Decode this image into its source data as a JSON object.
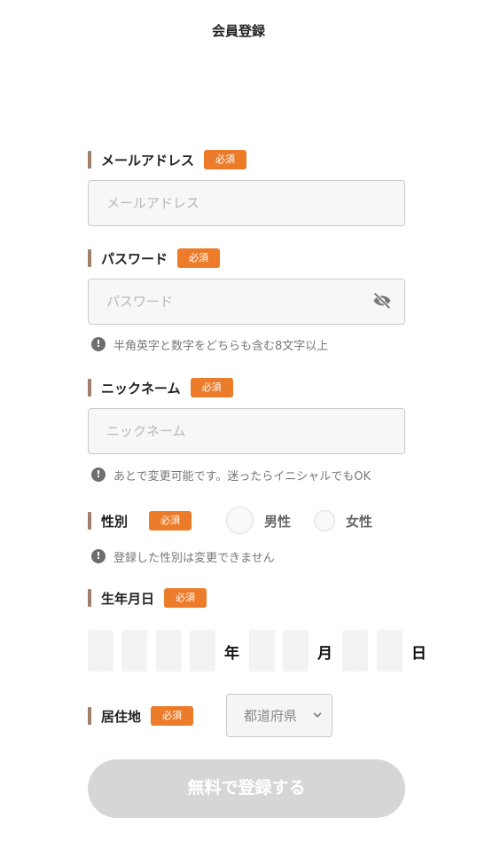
{
  "header": {
    "title": "会員登録"
  },
  "required_label": "必須",
  "email": {
    "label": "メールアドレス",
    "placeholder": "メールアドレス"
  },
  "password": {
    "label": "パスワード",
    "placeholder": "パスワード",
    "toggle_icon": "eye-slash-icon",
    "note": "半角英字と数字をどちらも含む8文字以上"
  },
  "nickname": {
    "label": "ニックネーム",
    "placeholder": "ニックネーム",
    "note": "あとで変更可能です。迷ったらイニシャルでもOK"
  },
  "gender": {
    "label": "性別",
    "options": [
      "男性",
      "女性"
    ],
    "note": "登録した性別は変更できません"
  },
  "birthdate": {
    "label": "生年月日",
    "units": {
      "year": "年",
      "month": "月",
      "day": "日"
    }
  },
  "residence": {
    "label": "居住地",
    "select_placeholder": "都道府県"
  },
  "submit": {
    "label": "無料で登録する"
  },
  "note_icon": "!",
  "colors": {
    "accent": "#ec7b2a",
    "label_bar": "#a0806a",
    "input_bg": "#f7f7f7",
    "button_disabled": "#d5d6d6"
  }
}
